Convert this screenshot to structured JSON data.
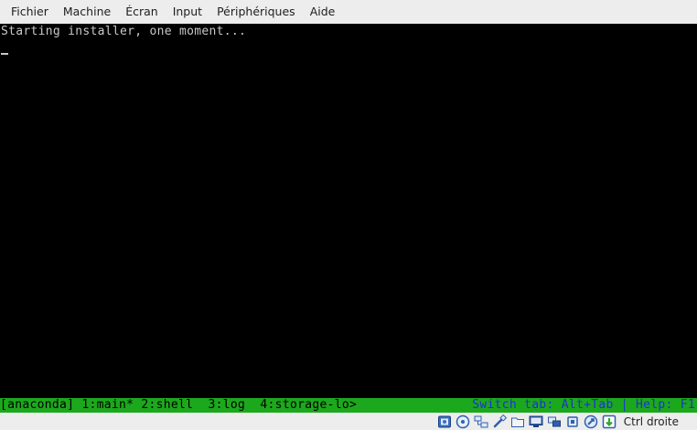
{
  "menubar": {
    "items": [
      "Fichier",
      "Machine",
      "Écran",
      "Input",
      "Périphériques",
      "Aide"
    ]
  },
  "console": {
    "line1": "Starting installer, one moment..."
  },
  "statusbar": {
    "left": "[anaconda] 1:main* 2:shell  3:log  4:storage-lo>",
    "right": "Switch tab: Alt+Tab | Help: F1"
  },
  "hostbar": {
    "icons": [
      "hard-disk-icon",
      "optical-drive-icon",
      "network-icon",
      "usb-icon",
      "shared-folders-icon",
      "display-icon",
      "video-capture-icon",
      "cpu-icon",
      "mouse-integration-icon",
      "keyboard-capture-icon"
    ],
    "host_key": "Ctrl droite"
  },
  "colors": {
    "status_bg": "#1ca81c",
    "status_right_fg": "#1e2fd8",
    "console_fg": "#c8c8c8"
  }
}
